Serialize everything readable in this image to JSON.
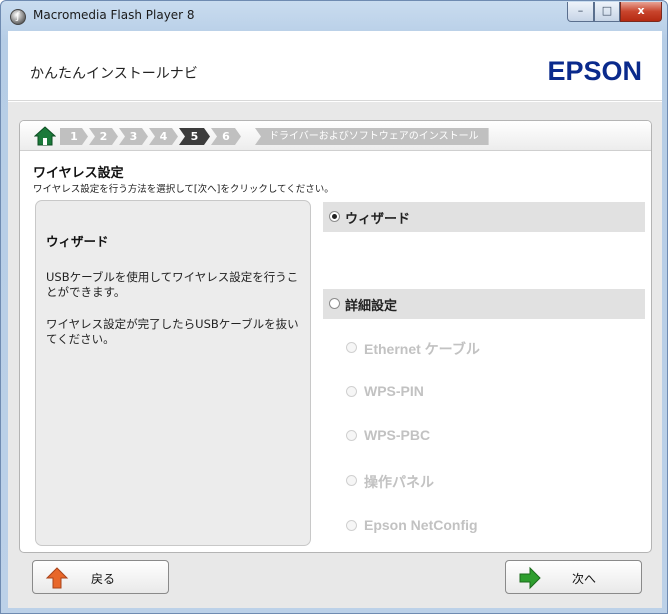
{
  "window": {
    "title": "Macromedia Flash Player 8",
    "minimize": "–",
    "maximize": "□",
    "close": "x"
  },
  "header": {
    "title": "かんたんインストールナビ",
    "brand": "EPSON"
  },
  "steps": [
    "1",
    "2",
    "3",
    "4",
    "5",
    "6"
  ],
  "active_step": "5",
  "final_step_label": "ドライバーおよびソフトウェアのインストール",
  "section": {
    "title": "ワイヤレス設定",
    "subtitle": "ワイヤレス設定を行う方法を選択して[次へ]をクリックしてください。"
  },
  "description": {
    "title": "ウィザード",
    "para1": "USBケーブルを使用してワイヤレス設定を行うことができます。",
    "para2": "ワイヤレス設定が完了したらUSBケーブルを抜いてください。"
  },
  "options": {
    "wizard": {
      "label": "ウィザード",
      "selected": true
    },
    "advanced": {
      "label": "詳細設定",
      "selected": false
    },
    "sub": [
      {
        "label": "Ethernet ケーブル",
        "enabled": false
      },
      {
        "label": "WPS-PIN",
        "enabled": false
      },
      {
        "label": "WPS-PBC",
        "enabled": false
      },
      {
        "label": "操作パネル",
        "enabled": false
      },
      {
        "label": "Epson NetConfig",
        "enabled": false
      }
    ]
  },
  "buttons": {
    "back": "戻る",
    "next": "次へ"
  },
  "colors": {
    "brand": "#0a2a8c",
    "back_arrow": "#e8672a",
    "next_arrow": "#2e9e2e",
    "active_step": "#3c3c3c"
  }
}
